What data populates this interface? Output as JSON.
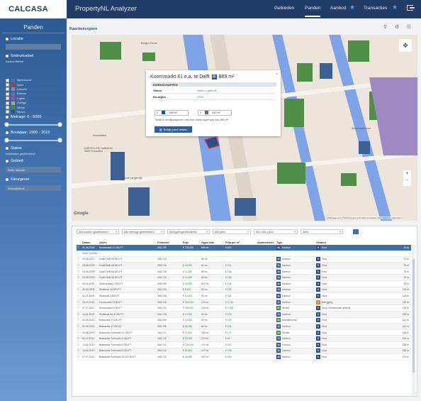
{
  "header": {
    "logo": "CALCASA",
    "app_title": "PropertyNL Analyzer",
    "nav": [
      {
        "label": "Gebieden",
        "active": false
      },
      {
        "label": "Panden",
        "active": true
      },
      {
        "label": "Aanbod",
        "active": false,
        "star": true
      },
      {
        "label": "Transacties",
        "active": false,
        "star": true
      }
    ],
    "star_glyph": "★"
  },
  "sidebar": {
    "title": "Panden",
    "locatie_label": "Locatie",
    "gebruiksdoel_label": "Gebruiksdoel",
    "legend_title": "Kantoor/Winkel",
    "legend": [
      {
        "label": "Bijeenkomst",
        "color": "#4a6fa5"
      },
      {
        "label": "Sport",
        "color": "#c0392b"
      },
      {
        "label": "Industrie",
        "color": "#7f8fa6"
      },
      {
        "label": "Kantoor",
        "color": "#5a7db0"
      },
      {
        "label": "Logies",
        "color": "#8e5aa6"
      },
      {
        "label": "Overige",
        "color": "#b8a06a"
      },
      {
        "label": "Winkel",
        "color": "#3c8c4a"
      },
      {
        "label": "Wonen",
        "color": "#2f4f8f"
      }
    ],
    "metrage_label": "Metrage: 0 - 5000",
    "bouwjaar_label": "Bouwjaar: 1900 - 2015",
    "status_label": "Status",
    "status_value": "Indelfstaan geselecteerd",
    "gebied_label": "Gebied",
    "gebied_value": "Geen selectie",
    "kleurgever_label": "Kleurgever",
    "kleurgever_value": "Gebruiksdoel"
  },
  "main": {
    "kaartweergave": "Kaartweergave",
    "tool_icons": [
      "person-icon",
      "bicycle-icon",
      "grid-icon"
    ]
  },
  "popup": {
    "title": "Koornmarkt 41 e.a. te Delft",
    "area": "889 m²",
    "section": "EIGENSCHAPPEN",
    "rows": [
      {
        "key": "Status",
        "value": "Pand in gebruik"
      },
      {
        "key": "Bouwjaar",
        "value": "1750"
      }
    ],
    "field1_count": "2",
    "field1_area": "106 m²",
    "field2_count": "2",
    "field2_area": "310 m²",
    "note": "Totaal 8 verblijfsobjecten met een totaal oppervlak van 889 m²",
    "button": "Bekijk pand details",
    "close": "×"
  },
  "map": {
    "google": "Google",
    "attribution": "Kaartgegevens ©2015 Google   Gebruiksvoorwaarden   Een kaartfout rapporteren",
    "zoom_in": "+",
    "zoom_out": "−",
    "labels": [
      "Bridges House",
      "Gasthuislaan",
      "Oude Delft",
      "Koornmarkt",
      "Dwarsstraat",
      "Nieuwe Langendijk",
      "UNESCO-IHE Institute for Water Education",
      "Binnenwatersloot"
    ]
  },
  "filters": [
    "Alle soorten geselecteerd",
    "Alle metrage geselecteerd",
    "Alle types geselecteerd",
    "Alle jaren",
    "Incl. excl. pand",
    "Alles"
  ],
  "table": {
    "headers": [
      "",
      "Datum",
      "Adres",
      "Postcode",
      "Prijs",
      "Oppervlak",
      "Prijs per m²",
      "Aanbodsoort",
      "Type",
      "Afstand"
    ],
    "more_link": "Meer Selectie",
    "rows": [
      {
        "d": "01-06-2016",
        "a": "Koornmarkt 41 DELFT",
        "pc": "2611 EE",
        "p": "€ 725.000",
        "o": "889 m²",
        "ppm": "€ 816",
        "ab": "Kantoor",
        "t": "Huur",
        "af": "10 m",
        "sel": true
      },
      {
        "d": "19-03-2011",
        "a": "Oude Delft 66 DELFT",
        "pc": "2611 CD",
        "p": "-",
        "o": "55 m²",
        "ppm": "-",
        "ab": "Kantoor",
        "t": "Huur",
        "af": "73 m"
      },
      {
        "d": "28-06-2009",
        "a": "Oude Delft 66 DELFT",
        "pc": "2611 CD",
        "p": "€ 18.000",
        "o": "84 m²",
        "ppm": "€ 214",
        "ab": "Kantoor",
        "t": "Huur",
        "af": "75 m"
      },
      {
        "d": "16-06-2009",
        "a": "Oude Delft 66 DELFT",
        "pc": "2611 CD",
        "p": "€ 11.280",
        "o": "68 m²",
        "ppm": "€ 166",
        "ab": "Kantoor",
        "t": "Huur",
        "af": "75 m"
      },
      {
        "d": "15-08-2009",
        "a": "Oude Delft 66 DELFT",
        "pc": "2611 CD",
        "p": "€ 11.280",
        "o": "68 m²",
        "ppm": "€ 166",
        "ab": "Kantoor",
        "t": "Huur",
        "af": "75 m"
      },
      {
        "d": "05-03-2012",
        "a": "Geitenplaats 2 DELFT",
        "pc": "2611 BH",
        "p": "€ 93.000",
        "o": "810 m²",
        "ppm": "€ 115",
        "ab": "Kantoor",
        "t": "Huur",
        "af": "93 m"
      },
      {
        "d": "26-03-2009",
        "a": "Wollenstr 1A DELFT",
        "pc": "2611 EN",
        "p": "€ 8.400",
        "o": "60 m²",
        "ppm": "€ 140",
        "ab": "Kantoor",
        "t": "Huur",
        "af": "114 m"
      },
      {
        "d": "11-07-2009",
        "a": "Wolstraat 1 DELFT",
        "pc": "2611 DN",
        "p": "€ 10.500",
        "o": "93 m²",
        "ppm": "€ 113",
        "ab": "Kantoor",
        "t": "Huur",
        "af": "116 m"
      },
      {
        "d": "16-10-2011",
        "a": "Koornmarkt 5 DELFT",
        "pc": "2611 EA",
        "p": "€ 340.000",
        "o": "125 m²",
        "ppm": "€ 2.720",
        "ab": "Kantoor",
        "t": "Belegging",
        "af": "130 m"
      },
      {
        "d": "07-07-2007",
        "a": "Koornmarkt 5 DELFT",
        "pc": "2611 EA",
        "p": "€ 296.000",
        "o": "125 m²",
        "ppm": "€ 2.368",
        "ab": "Winkel",
        "t": "Koop-/verhuurbaar gebruik",
        "af": "130 m"
      },
      {
        "d": "13-11-2009",
        "a": "Wolstraat 5A-8 DELFT",
        "pc": "2611 DN",
        "p": "€ 10.000",
        "o": "95 m²",
        "ppm": "€ 105",
        "ab": "Kantoor",
        "t": "Huur",
        "af": "133 m"
      },
      {
        "d": "03-09-2013",
        "a": "Brabantse 27 DELFT",
        "pc": "2611 RE",
        "p": "€ 14.000",
        "o": "64 m²",
        "ppm": "€ 219",
        "ab": "Bedrijfsruimte",
        "t": "Huur",
        "af": "141 m"
      },
      {
        "d": "01-05-2013",
        "a": "Brabantse 27 DELFT",
        "pc": "2611 RE",
        "p": "€ 20.350",
        "o": "84 m²",
        "ppm": "€ 242",
        "ab": "Kantoor",
        "t": "Huur",
        "af": "141 m"
      },
      {
        "d": "04-08-2007",
        "a": "Brabantse Turfmarkt 47 DELFT",
        "pc": "2611 CL",
        "p": "€ 31.800",
        "o": "180 m²",
        "ppm": "€ 177",
        "ab": "Winkel",
        "t": "Huur",
        "af": "146 m"
      },
      {
        "d": "01-12-2011",
        "a": "Brabantse Turfmarkt 6 DELFT",
        "pc": "2611 CK",
        "p": "€ 23.000",
        "o": "270 m²",
        "ppm": "€ 85",
        "ab": "Kantoor",
        "t": "Huur",
        "af": "154 m"
      },
      {
        "d": "13-02-2013",
        "a": "Brabantse Turfmarkt 6 DELFT",
        "pc": "2611 CK",
        "p": "€ 226.000",
        "o": "270 m²",
        "ppm": "€ 837",
        "ab": "Kantoor",
        "t": "Huur",
        "af": "154 m"
      },
      {
        "d": "13-02-2013",
        "a": "Brabantse Turfmarkt 6 DELFT",
        "pc": "2611 CK",
        "p": "€ 40.500",
        "o": "170 m²",
        "ppm": "€ 238",
        "ab": "Kantoor",
        "t": "Huur",
        "af": "156 m"
      },
      {
        "d": "27-07-2013",
        "a": "Brabantse Turfmarkt 32-34 DELFT",
        "pc": "2611 CK",
        "p": "€ 45.000",
        "o": "202 m²",
        "ppm": "€ 223",
        "ab": "Kantoor",
        "t": "Huur",
        "af": "170 m"
      }
    ]
  },
  "colors": {
    "navy": "#213c67",
    "accent": "#3e6ea6",
    "green_price": "#2e8f3b",
    "building_green": "#4f8f47",
    "building_blue": "#3c5f94",
    "canal": "#7ea3e6"
  }
}
